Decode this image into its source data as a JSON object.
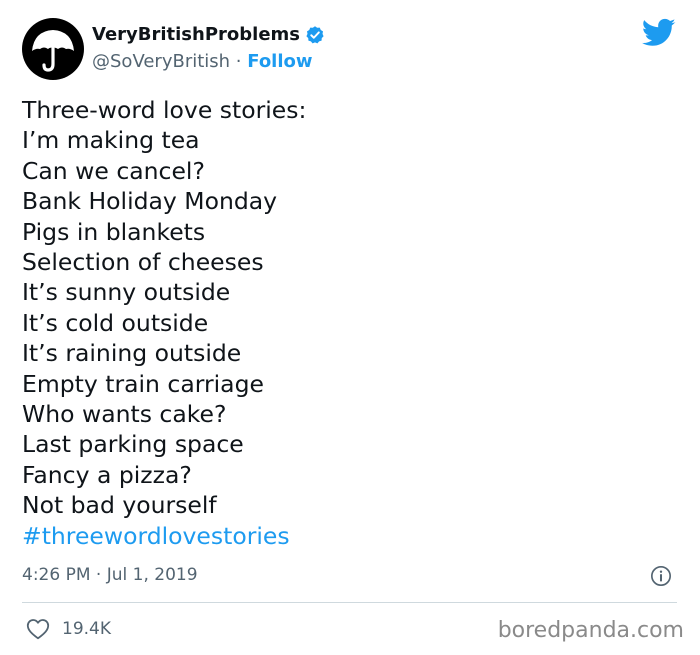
{
  "header": {
    "display_name": "VeryBritishProblems",
    "handle": "@SoVeryBritish",
    "separator": " · ",
    "follow_label": "Follow",
    "avatar_icon": "umbrella-icon",
    "verified_icon": "verified-badge-icon",
    "brand_icon": "twitter-bird-icon",
    "accent_color": "#1d9bf0"
  },
  "tweet": {
    "lines": [
      "Three-word love stories:",
      "I’m making tea",
      "Can we cancel?",
      "Bank Holiday Monday",
      "Pigs in blankets",
      "Selection of cheeses",
      "It’s sunny outside",
      "It’s cold outside",
      "It’s raining outside",
      "Empty train carriage",
      "Who wants cake?",
      "Last parking space",
      "Fancy a pizza?",
      "Not bad yourself"
    ],
    "hashtag": "#threewordlovestories"
  },
  "meta": {
    "timestamp": "4:26 PM · Jul 1, 2019",
    "info_icon": "info-icon"
  },
  "footer": {
    "like_icon": "heart-icon",
    "like_count": "19.4K",
    "watermark": "boredpanda.com"
  }
}
